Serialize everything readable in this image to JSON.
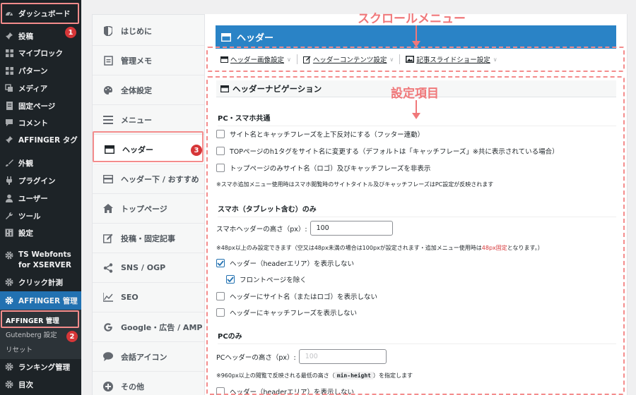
{
  "wp_menu": {
    "dashboard": "ダッシュボード",
    "items": [
      {
        "label": "投稿",
        "icon": "pin-icon"
      },
      {
        "label": "マイブロック",
        "icon": "grid-icon"
      },
      {
        "label": "パターン",
        "icon": "grid-icon"
      },
      {
        "label": "メディア",
        "icon": "media-icon"
      },
      {
        "label": "固定ページ",
        "icon": "page-icon"
      },
      {
        "label": "コメント",
        "icon": "comment-icon"
      },
      {
        "label": "AFFINGER タグ",
        "icon": "pin-icon"
      },
      {
        "label": "外観",
        "icon": "brush-icon"
      },
      {
        "label": "プラグイン",
        "icon": "plugin-icon"
      },
      {
        "label": "ユーザー",
        "icon": "user-icon"
      },
      {
        "label": "ツール",
        "icon": "wrench-icon"
      },
      {
        "label": "設定",
        "icon": "settings-icon"
      },
      {
        "label": "TS Webfonts for XSERVER",
        "icon": "gear-icon"
      },
      {
        "label": "クリック計測",
        "icon": "gear-icon"
      }
    ],
    "affinger": "AFFINGER 管理",
    "submenu": [
      "AFFINGER 管理",
      "Gutenberg 設定",
      "リセット"
    ],
    "ranking": "ランキング管理",
    "toc": "目次"
  },
  "settings_nav": [
    {
      "label": "はじめに",
      "icon": "shield-icon"
    },
    {
      "label": "管理メモ",
      "icon": "memo-icon"
    },
    {
      "label": "全体設定",
      "icon": "palette-icon"
    },
    {
      "label": "メニュー",
      "icon": "menu-icon"
    },
    {
      "label": "ヘッダー",
      "icon": "header-icon",
      "active": true
    },
    {
      "label": "ヘッダー下 / おすすめ",
      "icon": "header-below-icon"
    },
    {
      "label": "トップページ",
      "icon": "home-icon"
    },
    {
      "label": "投稿・固定記事",
      "icon": "edit-icon"
    },
    {
      "label": "SNS / OGP",
      "icon": "share-icon"
    },
    {
      "label": "SEO",
      "icon": "chart-icon"
    },
    {
      "label": "Google・広告 / AMP",
      "icon": "google-icon"
    },
    {
      "label": "会話アイコン",
      "icon": "chat-icon"
    },
    {
      "label": "その他",
      "icon": "plus-icon"
    }
  ],
  "panel": {
    "title": "ヘッダー",
    "scroll_menu": [
      "ヘッダー画像設定",
      "ヘッダーコンテンツ設定",
      "記事スライドショー設定"
    ],
    "section_title": "ヘッダーナビゲーション",
    "pc_sp_title": "PC・スマホ共通",
    "pc_sp_options": [
      {
        "label": "サイト名とキャッチフレーズを上下反対にする（フッター連動）",
        "checked": false
      },
      {
        "label": "TOPページのh1タグをサイト名に変更する（デフォルトは「キャッチフレーズ」※共に表示されている場合）",
        "checked": false
      },
      {
        "label": "トップページのみサイト名（ロゴ）及びキャッチフレーズを非表示",
        "checked": false
      }
    ],
    "pc_sp_note": "※スマホ追加メニュー使用時はスマホ閲覧時のサイトタイトル及びキャッチフレーズはPC設定が反映されます",
    "sp_title": "スマホ（タブレット含む）のみ",
    "sp_height_label": "スマホヘッダーの高さ（px）:",
    "sp_height_value": "100",
    "sp_note_a": "※48px以上のみ設定できます（空又は48px未満の場合は100pxが設定されます・追加メニュー使用時は",
    "sp_note_red": "48px固定",
    "sp_note_b": "となります。）",
    "sp_options": [
      {
        "label": "ヘッダー（headerエリア）を表示しない",
        "checked": true
      },
      {
        "label": "フロントページを除く",
        "checked": true
      },
      {
        "label": "ヘッダーにサイト名（またはロゴ）を表示しない",
        "checked": false
      },
      {
        "label": "ヘッダーにキャッチフレーズを表示しない",
        "checked": false
      }
    ],
    "pc_title": "PCのみ",
    "pc_height_label": "PCヘッダーの高さ（px）:",
    "pc_height_placeholder": "100",
    "pc_note_a": "※960px以上の閲覧で反映される最低の高さ（",
    "pc_note_code": "min-height",
    "pc_note_b": "）を指定します",
    "pc_option": {
      "label": "ヘッダー（headerエリア）を表示しない",
      "checked": false
    }
  },
  "annotations": {
    "scroll_menu_label": "スクロールメニュー",
    "settings_label": "設定項目",
    "markers": [
      "1",
      "2",
      "3"
    ],
    "color": "#f48c8c"
  }
}
